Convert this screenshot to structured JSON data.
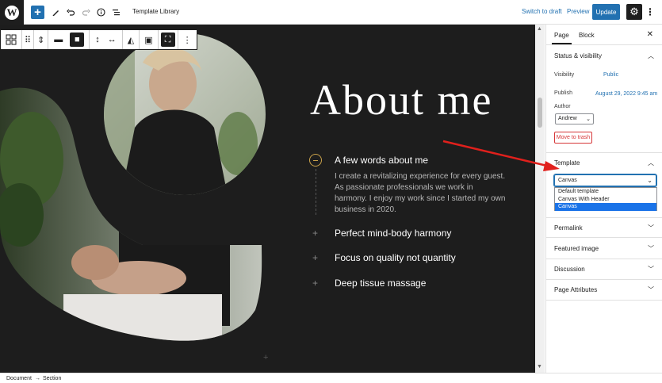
{
  "topbar": {
    "doc_title": "Template Library",
    "switch_to_draft": "Switch to draft",
    "preview": "Preview",
    "update": "Update"
  },
  "content": {
    "title": "About me",
    "feature_heading": "A few words about me",
    "feature_text": "I create a revitalizing experience for every guest. As passionate professionals we work in harmony. I enjoy my work since I started my own business in 2020.",
    "accordion": [
      {
        "label": "Perfect mind-body harmony"
      },
      {
        "label": "Focus on quality not quantity"
      },
      {
        "label": "Deep tissue massage"
      }
    ]
  },
  "sidebar": {
    "tabs": {
      "page": "Page",
      "block": "Block"
    },
    "status_visibility": {
      "title": "Status & visibility",
      "visibility_label": "Visibility",
      "visibility_value": "Public",
      "publish_label": "Publish",
      "publish_value": "August 29, 2022 9:45 am",
      "author_label": "Author",
      "author_value": "Andrew",
      "trash": "Move to trash"
    },
    "template": {
      "title": "Template",
      "selected": "Canvas",
      "options": [
        "Default template",
        "Canvas With Header",
        "Canvas"
      ]
    },
    "panels": [
      "Permalink",
      "Featured image",
      "Discussion",
      "Page Attributes"
    ]
  },
  "breadcrumb": {
    "document": "Document",
    "separator": "→",
    "section": "Section"
  },
  "colors": {
    "accent": "#2271b1",
    "canvas_bg": "#1d1d1d",
    "highlight": "#1a73e8",
    "danger": "#d63638",
    "arrow": "#e0201c"
  }
}
